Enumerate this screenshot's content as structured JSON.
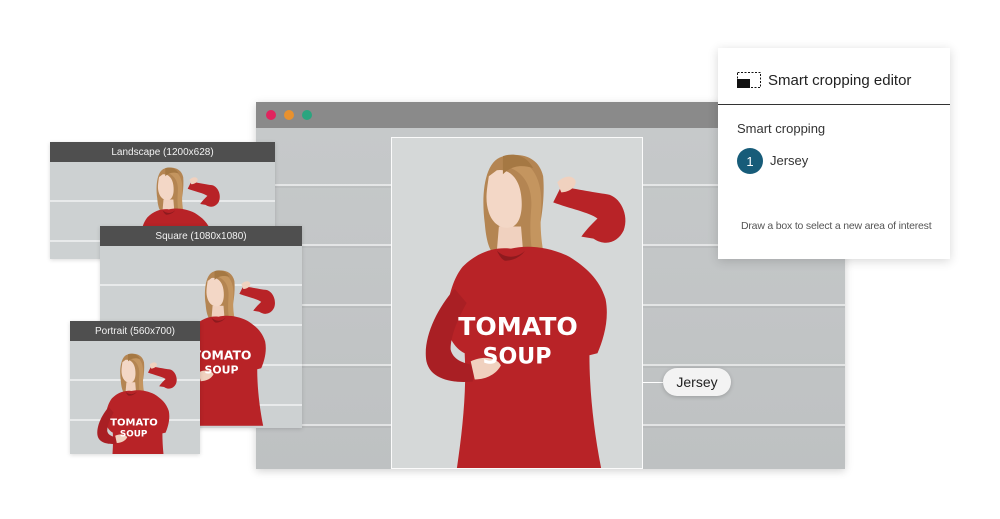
{
  "window": {
    "title_dots": [
      {
        "name": "close",
        "color": "#e0245e"
      },
      {
        "name": "minimize",
        "color": "#e8912e"
      },
      {
        "name": "maximize",
        "color": "#2aa57f"
      }
    ]
  },
  "image": {
    "shirt_text_line1": "TOMATO",
    "shirt_text_line2": "SOUP",
    "shirt_color": "#b82327"
  },
  "annotation": {
    "label": "Jersey"
  },
  "thumbnails": [
    {
      "label": "Landscape (1200x628)"
    },
    {
      "label": "Square (1080x1080)"
    },
    {
      "label": "Portrait (560x700)"
    }
  ],
  "editor": {
    "title": "Smart cropping editor",
    "section": "Smart cropping",
    "items": [
      {
        "index": "1",
        "label": "Jersey",
        "badge_color": "#175c79"
      }
    ],
    "hint": "Draw a box to select a new area of interest"
  }
}
